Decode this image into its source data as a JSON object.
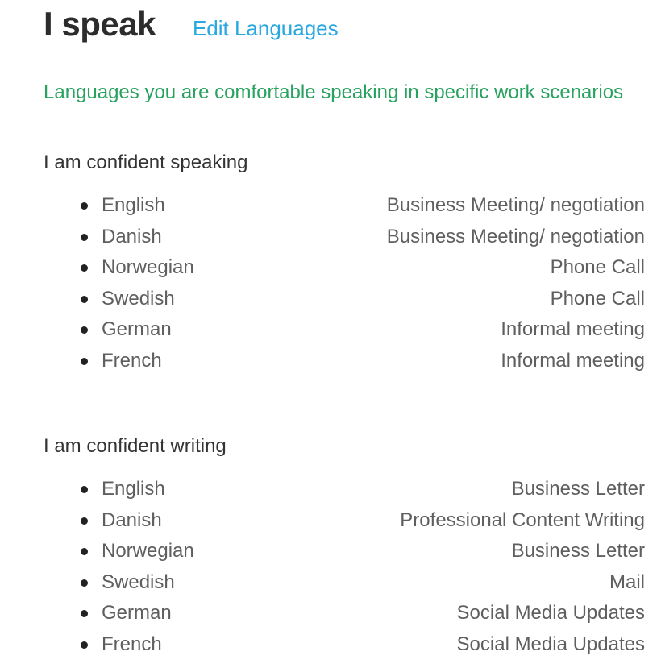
{
  "header": {
    "title": "I speak",
    "edit_link": "Edit Languages"
  },
  "subtitle": "Languages you are comfortable speaking in specific work scenarios",
  "speaking": {
    "heading": "I am confident speaking",
    "items": [
      {
        "language": "English",
        "scenario": "Business Meeting/ negotiation"
      },
      {
        "language": "Danish",
        "scenario": "Business Meeting/ negotiation"
      },
      {
        "language": "Norwegian",
        "scenario": "Phone Call"
      },
      {
        "language": "Swedish",
        "scenario": "Phone Call"
      },
      {
        "language": "German",
        "scenario": "Informal meeting"
      },
      {
        "language": "French",
        "scenario": "Informal meeting"
      }
    ]
  },
  "writing": {
    "heading": "I am confident writing",
    "items": [
      {
        "language": "English",
        "scenario": "Business Letter"
      },
      {
        "language": "Danish",
        "scenario": "Professional Content Writing"
      },
      {
        "language": "Norwegian",
        "scenario": "Business Letter"
      },
      {
        "language": "Swedish",
        "scenario": "Mail"
      },
      {
        "language": "German",
        "scenario": "Social Media Updates"
      },
      {
        "language": "French",
        "scenario": "Social Media Updates"
      }
    ]
  },
  "colors": {
    "title": "#2c2c2c",
    "link": "#29a7df",
    "subtitle": "#27a25f",
    "text": "#5f5f5f"
  }
}
